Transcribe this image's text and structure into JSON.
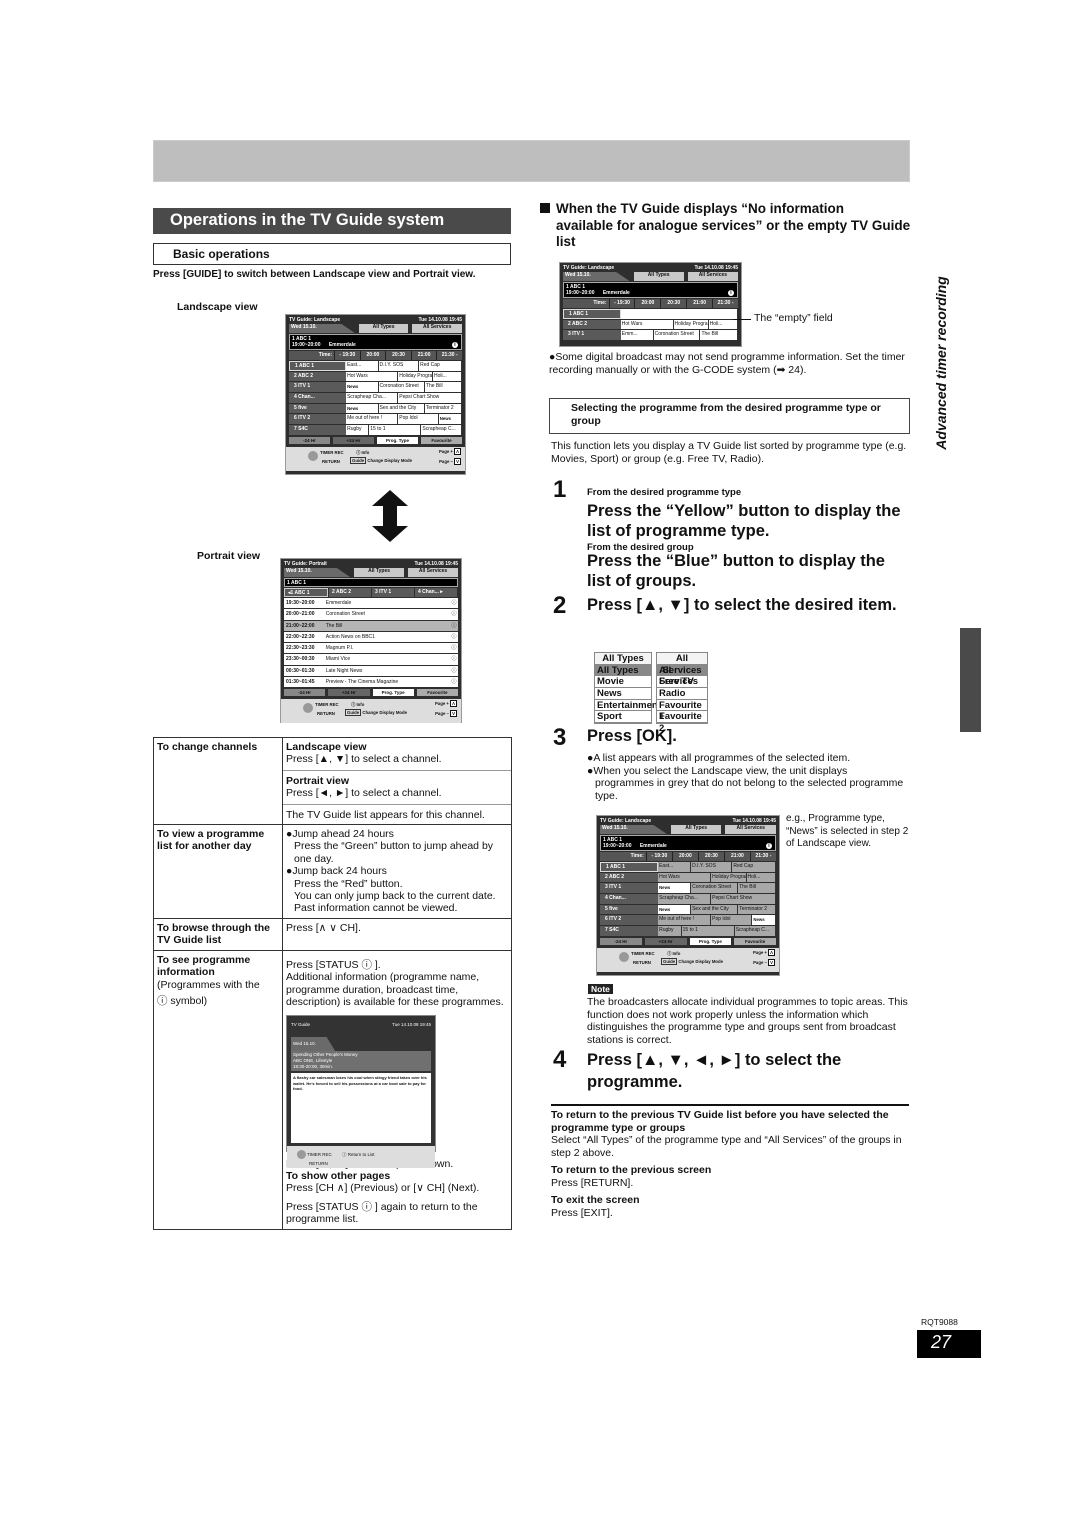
{
  "section": {
    "title": "Operations in the TV Guide system",
    "subheading": "Basic operations",
    "intro": "Press [GUIDE] to switch between Landscape view and Portrait view.",
    "landscape_caption": "Landscape view",
    "portrait_caption": "Portrait view"
  },
  "tv_landscape": {
    "title": "TV Guide: Landscape",
    "datetime": "Tue 14.10.08 19:45",
    "date_tab": "Wed 15.10.",
    "types_tab": "All Types",
    "services_tab": "All Services",
    "info_channel": "1 ABC 1",
    "info_time": "19:00~20:00",
    "info_programme": "Emmerdale",
    "info_icon": "i",
    "times": [
      "Time:",
      "- 19:30",
      "20:00",
      "20:30",
      "21:00",
      "21:30 -"
    ],
    "rows": [
      {
        "channel": "1   ABC 1",
        "programmes": [
          "East...",
          "D.I.Y. SOS",
          "Red Cap"
        ]
      },
      {
        "channel": "2   ABC 2",
        "programmes": [
          "Hot Wars",
          "Holiday Programme",
          "Holi..."
        ]
      },
      {
        "channel": "3   ITV 1",
        "programmes": [
          "News",
          "Coronation Street",
          "The Bill"
        ]
      },
      {
        "channel": "4   Chan...",
        "programmes": [
          "Scrapheap Cha...",
          "Pepsi Chart Show"
        ]
      },
      {
        "channel": "5   five",
        "programmes": [
          "News",
          "Sex and the City",
          "Terminator 2"
        ]
      },
      {
        "channel": "6   ITV 2",
        "programmes": [
          "Me out of here !",
          "Pop Idol",
          "News"
        ]
      },
      {
        "channel": "7   S4C",
        "programmes": [
          "Rugby",
          "15 to 1",
          "Scrapheap C..."
        ]
      }
    ],
    "buttons": [
      "-24 Hr",
      "+24 Hr",
      "Prog. Type",
      "Favourite"
    ],
    "footer": {
      "timer_rec": "TIMER REC",
      "return": "RETURN",
      "info": "ⓘ Info",
      "guide_key": "Guide",
      "change_mode": "Change Display Mode",
      "page_up": "Page +",
      "page_down": "Page –",
      "page_up_key": "Λ",
      "page_down_key": "V"
    }
  },
  "tv_portrait": {
    "title": "TV Guide:  Portrait",
    "datetime": "Tue 14.10.08 19:45",
    "date_tab": "Wed 15.10.",
    "types_tab": "All Types",
    "services_tab": "All Services",
    "info_channel": "1 ABC 1",
    "channels": [
      "◂1   ABC 1",
      "2   ABC 2",
      "3       ITV 1",
      "4   Chan... ▸"
    ],
    "rows": [
      {
        "time": "19:30~20:00",
        "name": "Emmerdale",
        "highlighted": false
      },
      {
        "time": "20:00~21:00",
        "name": "Coronation Street",
        "highlighted": false
      },
      {
        "time": "21:00~22:00",
        "name": "The Bill",
        "highlighted": true
      },
      {
        "time": "22:00~22:30",
        "name": "Action News on BBC1",
        "highlighted": false
      },
      {
        "time": "22:30~23:30",
        "name": "Magnum P.I.",
        "highlighted": false
      },
      {
        "time": "23:30~00:30",
        "name": "Miami Vice",
        "highlighted": false
      },
      {
        "time": "00:30~01:30",
        "name": "Late Night News",
        "highlighted": false
      },
      {
        "time": "01:30~01:45",
        "name": "Preview - The Cinema Magazine",
        "highlighted": false
      }
    ],
    "info_icon": "ⓘ",
    "buttons": [
      "-24 Hr",
      "+24 Hr",
      "Prog. Type",
      "Favourite"
    ]
  },
  "ops_table": {
    "change_channels": {
      "key": "To change channels",
      "landscape_head": "Landscape view",
      "landscape_text": "Press [▲, ▼] to select a channel.",
      "portrait_head": "Portrait view",
      "portrait_text": "Press [◄, ►] to select a channel.",
      "note": "The TV Guide list appears for this channel."
    },
    "another_day": {
      "key": "To view a programme list for another day",
      "b1": "●Jump ahead 24 hours",
      "b1_text": "Press the “Green” button to jump ahead by one day.",
      "b2": "●Jump back 24 hours",
      "b2_text1": "Press the “Red” button.",
      "b2_text2": "You can only jump back to the current date. Past information cannot be viewed."
    },
    "browse": {
      "key": "To browse through the TV Guide list",
      "text": "Press [∧  ∨ CH]."
    },
    "programme_info": {
      "key": "To see programme information",
      "key_sub": "(Programmes with the",
      "key_sub2": "ⓘ  symbol)",
      "text1": "Press [STATUS ⓘ ].",
      "text2": "Additional information (programme name, programme duration, broadcast time, description) is available for these programmes.",
      "scroll": "Press [▲, ▼] to scroll up and down.",
      "other_pages_head": "To show other pages",
      "other_pages": "Press [CH ∧] (Previous) or [∨ CH] (Next).",
      "return_text": "Press [STATUS ⓘ ] again to return to the programme list."
    }
  },
  "tv_info": {
    "title": "TV Guide",
    "datetime": "Tue 14.10.08 19:45",
    "date_tab": "Wed 15.10.",
    "programme": "Spending Other People's Money",
    "channel_genre": "ABC ONE, Lifestyle",
    "time": "19:30-20:00, 30min.",
    "description": "A flashy car salesman loses his cool when stingy friend takes over his wallet. He's forced to sell his possessions at a car boot sale to pay for food.",
    "timer_rec": "TIMER REC",
    "return": "RETURN",
    "return_list": "ⓘ Return to List"
  },
  "right": {
    "heading_line1": "When the TV Guide displays “No information",
    "heading_rest": "available for analogue services” or the empty TV Guide list",
    "empty_label": "The “empty” field",
    "bullet1": "●Some digital broadcast may not send programme information. Set the timer recording manually or with the G-CODE system (➡ 24).",
    "select_box": "Selecting the programme from the desired programme type or group",
    "select_desc": "This function lets you display a TV Guide list sorted by programme type (e.g. Movies, Sport) or group (e.g. Free TV, Radio).",
    "step1_num": "1",
    "step1_sub": "From the desired programme type",
    "step1_a": "Press the “Yellow” button to display the list of programme type.",
    "step1_sub2": "From the desired group",
    "step1_b": "Press the “Blue” button to display the list of groups.",
    "step2_num": "2",
    "step2": "Press [▲, ▼] to select the desired item.",
    "types_list": [
      "All Types",
      "All Types",
      "Movie",
      "News",
      "Entertainment",
      "Sport"
    ],
    "groups_list": [
      "All Services",
      "All Services",
      "Free TV",
      "Radio",
      "Favourite 1",
      "Favourite 2"
    ],
    "step3_num": "3",
    "step3": "Press [OK].",
    "step3_b1": "●A list appears with all programmes of the selected item.",
    "step3_b2": "●When you select the Landscape view, the unit displays programmes in grey that do not belong to the selected programme type.",
    "eg": "e.g., Programme type, “News” is selected in step 2 of Landscape view.",
    "note_label": "Note",
    "note": "The broadcasters allocate individual programmes to topic areas. This function does not work properly unless the information which distinguishes the programme type and groups sent from broadcast stations is correct.",
    "step4_num": "4",
    "step4": "Press [▲, ▼, ◄, ►] to select the programme.",
    "return_prev_list_head": "To return to the previous TV Guide list before you have selected the programme type or groups",
    "return_prev_list": "Select “All Types” of the programme type and “All Services” of the groups in step 2 above.",
    "return_prev_screen_head": "To return to the previous screen",
    "return_prev_screen": "Press [RETURN].",
    "exit_head": "To exit the screen",
    "exit": "Press [EXIT]."
  },
  "tv_empty": {
    "rows": [
      {
        "channel": "1   ABC 1",
        "programmes": []
      },
      {
        "channel": "2   ABC 2",
        "programmes": [
          "Hot Wars",
          "Holiday Programme",
          "Holi..."
        ]
      },
      {
        "channel": "3   ITV 1",
        "programmes": [
          "Emm...",
          "Coronation Street",
          "The Bill"
        ]
      }
    ]
  },
  "side_label": "Advanced timer recording",
  "doc_code": "RQT9088",
  "page_number": "27"
}
